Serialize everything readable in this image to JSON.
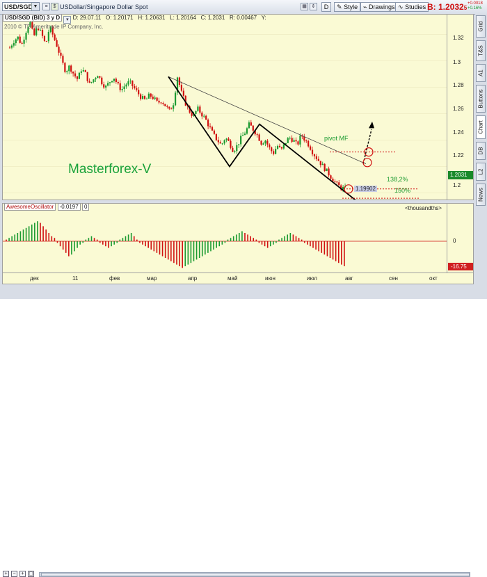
{
  "toolbar": {
    "symbol": "USD/SGD",
    "description": "USDollar/Singapore Dollar Spot",
    "style_label": "Style",
    "drawings_label": "Drawings",
    "studies_label": "Studies",
    "bid_label": "B: 1.2032",
    "bid_sub": "5",
    "change_abs": "+0.0018",
    "change_pct": "+0.16%",
    "d_button": "D"
  },
  "chart_header": {
    "title": "USD/SGD (BID) 3 y D",
    "date": "D: 29.07.11",
    "open": "O: 1.20171",
    "high": "H: 1.20631",
    "low": "L: 1.20164",
    "close": "C: 1.2031",
    "range": "R: 0.00467",
    "y": "Y:",
    "copyright": "2010 © TD Ameritrade IP Company, Inc."
  },
  "annotations": {
    "watermark": "Masterforex-V",
    "pivot": "pivot MF",
    "fib1": "138,2%",
    "fib2": "150%",
    "price_box": "1.19902"
  },
  "price_axis": [
    "1.32",
    "1.3",
    "1.28",
    "1.26",
    "1.24",
    "1.22",
    "1.2"
  ],
  "last_price": "1.2031",
  "oscillator": {
    "name": "AwesomeOscillator",
    "value": "-0.0197",
    "extra": "0",
    "units": "<thousandths>",
    "zero_label": "0",
    "last_value": "-16.75"
  },
  "x_axis": [
    "дек",
    "11",
    "фев",
    "мар",
    "апр",
    "май",
    "июн",
    "июл",
    "авг",
    "сен",
    "окт"
  ],
  "side_tabs": [
    "Grid",
    "T&S",
    "A1",
    "Buttons",
    "Chart",
    "DB",
    "L2",
    "News"
  ],
  "colors": {
    "up": "#1a9a30",
    "down": "#d01010",
    "bg": "#fafad4"
  },
  "chart_data": {
    "type": "candlestick",
    "title": "USD/SGD (BID) 3 y D",
    "ylim": [
      1.195,
      1.335
    ],
    "close_path": [
      1.31,
      1.315,
      1.318,
      1.312,
      1.322,
      1.33,
      1.318,
      1.326,
      1.32,
      1.312,
      1.326,
      1.318,
      1.31,
      1.3,
      1.292,
      1.296,
      1.29,
      1.286,
      1.294,
      1.29,
      1.282,
      1.286,
      1.29,
      1.284,
      1.28,
      1.284,
      1.288,
      1.282,
      1.278,
      1.282,
      1.284,
      1.28,
      1.276,
      1.272,
      1.27,
      1.274,
      1.272,
      1.268,
      1.27,
      1.266,
      1.262,
      1.268,
      1.288,
      1.276,
      1.268,
      1.262,
      1.258,
      1.264,
      1.26,
      1.256,
      1.25,
      1.244,
      1.24,
      1.236,
      1.242,
      1.238,
      1.232,
      1.236,
      1.242,
      1.246,
      1.252,
      1.248,
      1.244,
      1.238,
      1.24,
      1.234,
      1.23,
      1.236,
      1.232,
      1.238,
      1.242,
      1.24,
      1.236,
      1.244,
      1.24,
      1.236,
      1.23,
      1.226,
      1.222,
      1.218,
      1.214,
      1.21,
      1.206,
      1.204,
      1.203
    ],
    "oscillator": [
      2,
      4,
      6,
      8,
      10,
      12,
      14,
      16,
      18,
      20,
      22,
      24,
      22,
      18,
      14,
      10,
      6,
      4,
      -2,
      -6,
      -10,
      -14,
      -18,
      -16,
      -12,
      -8,
      -4,
      -2,
      2,
      4,
      6,
      4,
      2,
      -2,
      -4,
      -6,
      -8,
      -6,
      -4,
      -2,
      2,
      4,
      6,
      8,
      10,
      6,
      2,
      -2,
      -4,
      -6,
      -8,
      -10,
      -12,
      -14,
      -16,
      -18,
      -20,
      -22,
      -24,
      -26,
      -28,
      -30,
      -32,
      -30,
      -28,
      -26,
      -24,
      -22,
      -20,
      -18,
      -16,
      -14,
      -12,
      -10,
      -8,
      -6,
      -4,
      -2,
      2,
      4,
      6,
      8,
      10,
      12,
      10,
      8,
      6,
      4,
      2,
      -2,
      -4,
      -6,
      -8,
      -6,
      -4,
      -2,
      2,
      4,
      6,
      8,
      10,
      8,
      6,
      4,
      2,
      -2,
      -4,
      -6,
      -8,
      -10,
      -12,
      -14,
      -16,
      -18,
      -20,
      -22,
      -24,
      -26,
      -28,
      -30
    ]
  }
}
